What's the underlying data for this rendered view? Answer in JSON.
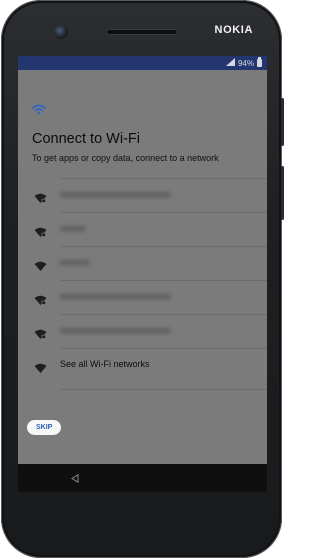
{
  "device": {
    "brand": "NOKIA"
  },
  "status_bar": {
    "battery_text": "94%"
  },
  "wifi_setup": {
    "title": "Connect to Wi-Fi",
    "subtitle": "To get apps or copy data, connect to a network",
    "networks": [
      {
        "name": "xxxxxxxxxxxxxxxxxxxxxxxxxx",
        "secured": true,
        "icon": "wifi-locked-icon"
      },
      {
        "name": "xxxxxx",
        "secured": true,
        "icon": "wifi-locked-icon"
      },
      {
        "name": "xxxxxxx",
        "secured": false,
        "icon": "wifi-icon"
      },
      {
        "name": "xxxxxxxxxxxxxxxxxxxxxxxxxx",
        "secured": true,
        "icon": "wifi-locked-icon"
      },
      {
        "name": "xxxxxxxxxxxxxxxxxxxxxxxxxx",
        "secured": true,
        "icon": "wifi-locked-icon"
      }
    ],
    "see_all_label": "See all Wi-Fi networks",
    "skip_label": "SKIP"
  },
  "colors": {
    "accent": "#2b62b5",
    "status_bar": "#23366f",
    "screen_dim": "#7b7b7b"
  }
}
